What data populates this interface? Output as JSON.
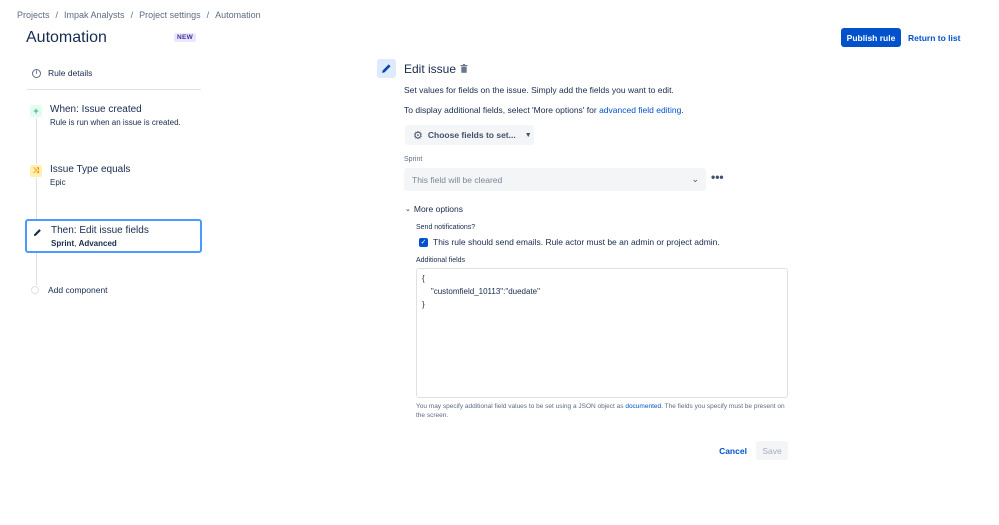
{
  "breadcrumbs": [
    "Projects",
    "Impak Analysts",
    "Project settings",
    "Automation"
  ],
  "breadcrumb_separator": "/",
  "page": {
    "title": "Automation",
    "badge": "NEW"
  },
  "header": {
    "publish_label": "Publish rule",
    "return_label": "Return to list"
  },
  "sidebar": {
    "rule_details": "Rule details",
    "trigger": {
      "title": "When: Issue created",
      "subtitle": "Rule is run when an issue is created."
    },
    "condition": {
      "title": "Issue Type equals",
      "subtitle": "Epic"
    },
    "action": {
      "title": "Then: Edit issue fields",
      "subtitle_bold1": "Sprint",
      "subtitle_sep": ", ",
      "subtitle_bold2": "Advanced"
    },
    "add_component": "Add component"
  },
  "editor": {
    "title": "Edit issue",
    "desc1": "Set values for fields on the issue. Simply add the fields you want to edit.",
    "desc2_prefix": "To display additional fields, select 'More options' for ",
    "desc2_link": "advanced field editing",
    "desc2_suffix": ".",
    "choose_fields": "Choose fields to set...",
    "sprint_label": "Sprint",
    "sprint_placeholder": "This field will be cleared",
    "more_options": "More options",
    "send_notifications_label": "Send notifications?",
    "send_notifications_text": "This rule should send emails. Rule actor must be an admin or project admin.",
    "send_notifications_checked": true,
    "additional_fields_label": "Additional fields",
    "additional_fields_lines": [
      "{",
      "    \"customfield_10113\":\"duedate\"",
      "}"
    ],
    "help_prefix": "You may specify additional field values to be set using a JSON object as ",
    "help_link": "documented",
    "help_suffix": ". The fields you specify must be present on the screen.",
    "cancel_label": "Cancel",
    "save_label": "Save"
  },
  "colors": {
    "primary": "#0052cc",
    "selected_border": "#4c9aff",
    "trigger_accent": "#36b37e",
    "condition_accent": "#ff8b00"
  }
}
